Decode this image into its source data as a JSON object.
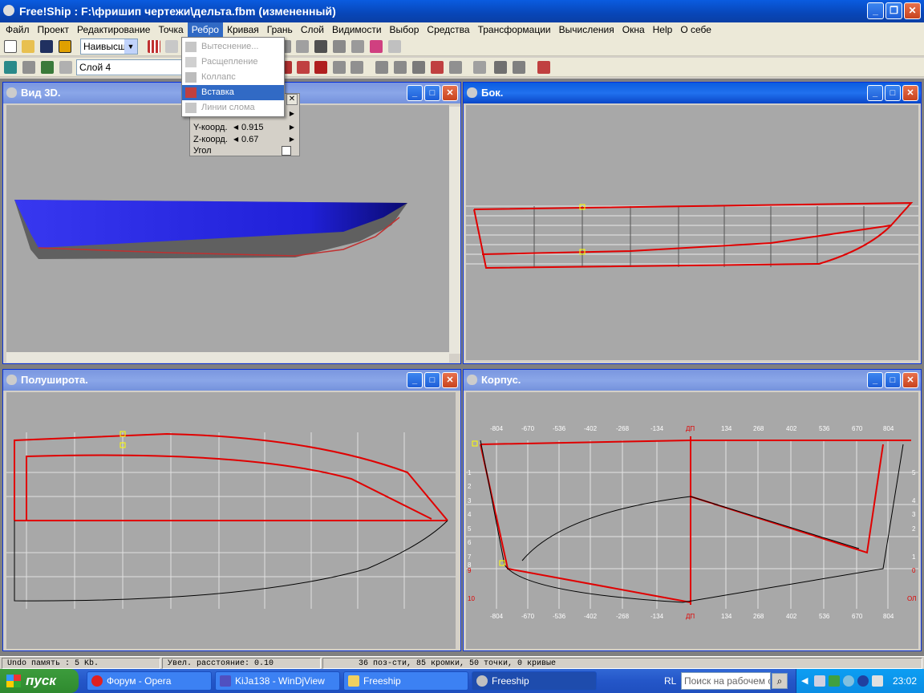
{
  "window": {
    "title": "Free!Ship  : F:\\фришип чертежи\\дельта.fbm (измененный)"
  },
  "menu": [
    "Файл",
    "Проект",
    "Редактирование",
    "Точка",
    "Ребро",
    "Кривая",
    "Грань",
    "Слой",
    "Видимости",
    "Выбор",
    "Средства",
    "Трансформации",
    "Вычисления",
    "Окна",
    "Help",
    "О себе"
  ],
  "toolbar": {
    "precision": "Наивысш.",
    "layer": "Слой 4"
  },
  "edge_menu": {
    "items": [
      "Вытеснение...",
      "Расщепление",
      "Коллапс",
      "Вставка",
      "Линии слома"
    ]
  },
  "point_panel": {
    "y_label": "Y-коорд.",
    "y_value": "0.915",
    "z_label": "Z-коорд.",
    "z_value": "0.67",
    "angle_label": "Угол"
  },
  "views": {
    "v3d": "Вид 3D.",
    "profile": "Бок.",
    "plan": "Полуширота.",
    "body": "Корпус."
  },
  "body_ticks_top": [
    "-804",
    "-670",
    "-536",
    "-402",
    "-268",
    "-134",
    "ДП",
    "134",
    "268",
    "402",
    "536",
    "670",
    "804"
  ],
  "body_ticks_bottom": [
    "-804",
    "-670",
    "-536",
    "-402",
    "-268",
    "-134",
    "ДП",
    "134",
    "268",
    "402",
    "536",
    "670",
    "804"
  ],
  "body_left": [
    "1",
    "2",
    "3",
    "4",
    "5",
    "6",
    "7",
    "8",
    "9",
    "10"
  ],
  "body_right": [
    "5",
    "4",
    "3",
    "2",
    "1",
    "0",
    "ОЛ"
  ],
  "status": {
    "undo": "Undo память : 5 Kb.",
    "dist": "Увел. расстояние: 0.10",
    "info": "36 поз-сти, 85 кромки, 50 точки, 0 кривые"
  },
  "taskbar": {
    "start": "пуск",
    "tasks": [
      "Форум - Opera",
      "KiJa138 - WinDjView",
      "Freeship",
      "Freeship"
    ],
    "lang": "RL",
    "search": "Поиск на рабочем ст",
    "clock": "23:02"
  }
}
